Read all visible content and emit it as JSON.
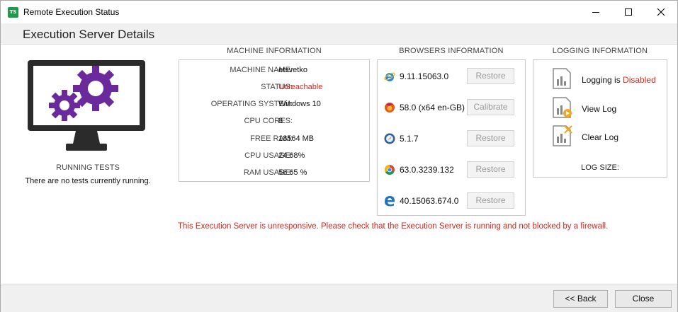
{
  "window": {
    "app_icon_text": "TS",
    "title": "Remote Execution Status",
    "controls": {
      "minimize": "minimize-icon",
      "maximize": "maximize-icon",
      "close": "close-icon"
    }
  },
  "header": {
    "title": "Execution Server Details"
  },
  "running_tests": {
    "title": "RUNNING TESTS",
    "message": "There are no tests currently running."
  },
  "machine_info": {
    "title": "MACHINE INFORMATION",
    "rows": [
      {
        "label": "MACHINE NAME:",
        "value": "etsvetko"
      },
      {
        "label": "STATUS:",
        "value": "Unreachable"
      },
      {
        "label": "OPERATING SYSTEM:",
        "value": "Windows 10"
      },
      {
        "label": "CPU CORES:",
        "value": "8"
      },
      {
        "label": "FREE RAM:",
        "value": "18564 MB"
      },
      {
        "label": "CPU USAGE:",
        "value": "24.68%"
      },
      {
        "label": "RAM USAGE:",
        "value": "56.65 %"
      }
    ]
  },
  "browsers_info": {
    "title": "BROWSERS INFORMATION",
    "browsers": [
      {
        "icon": "internet-explorer-icon",
        "version": "9.11.15063.0",
        "button": "Restore"
      },
      {
        "icon": "firefox-icon",
        "version": "58.0 (x64 en-GB)",
        "button": "Calibrate"
      },
      {
        "icon": "safari-icon",
        "version": "5.1.7",
        "button": "Restore"
      },
      {
        "icon": "chrome-icon",
        "version": "63.0.3239.132",
        "button": "Restore"
      },
      {
        "icon": "edge-icon",
        "version": "40.15063.674.0",
        "button": "Restore"
      }
    ]
  },
  "logging_info": {
    "title": "LOGGING INFORMATION",
    "logging_prefix": "Logging is ",
    "logging_state": "Disabled",
    "view_log": "View Log",
    "clear_log": "Clear Log",
    "log_size_label": "LOG SIZE:"
  },
  "error_message": "This Execution Server is unresponsive. Please check that the Execution Server is running and not blocked by a firewall.",
  "footer": {
    "back": "<< Back",
    "close": "Close"
  },
  "colors": {
    "accent_purple": "#6a2a9c",
    "error_red": "#d9261c",
    "monitor_dark": "#2b2b2b",
    "app_green": "#1f9a48"
  }
}
